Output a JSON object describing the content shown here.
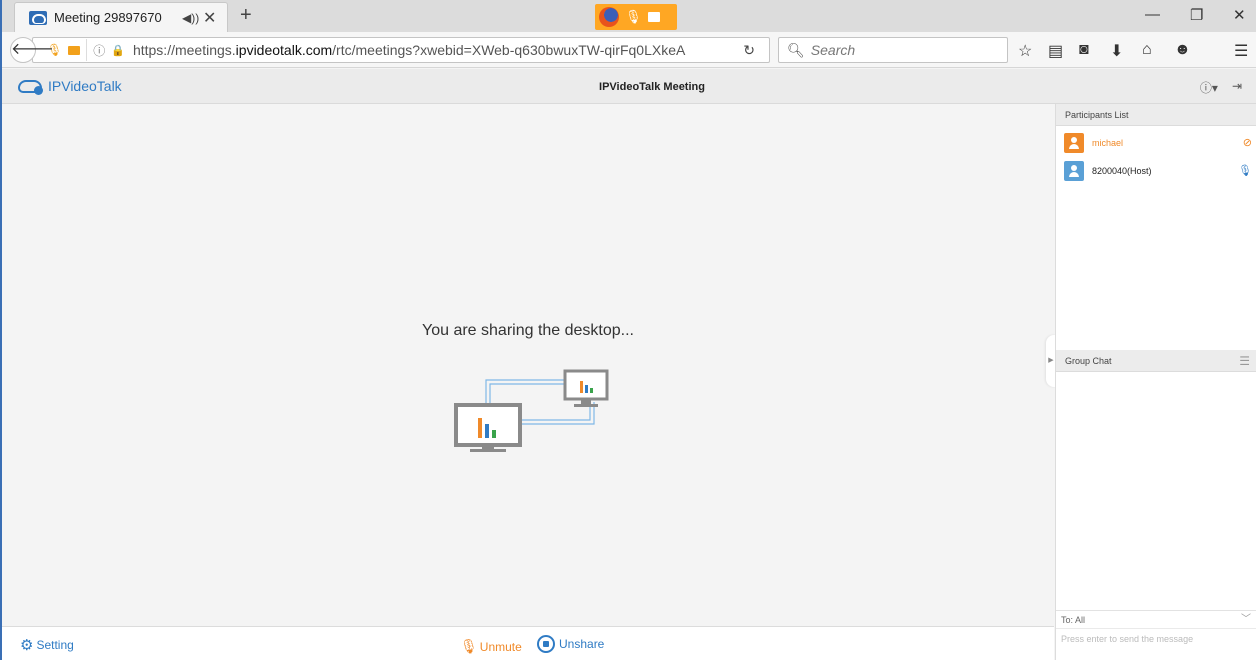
{
  "browser": {
    "tab_title": "Meeting 29897670",
    "speaker_icon": "speaker-icon",
    "close_tab": "✕",
    "new_tab": "+",
    "url_prefix": "https://meetings.",
    "url_domain": "ipvideotalk.com",
    "url_path": "/rtc/meetings?xwebid=XWeb-q630bwuxTW-qirFq0LXkeA",
    "search_placeholder": "Search",
    "window_controls": {
      "minimize": "—",
      "restore": "❐",
      "close": "✕"
    }
  },
  "app": {
    "logo_text": "IPVideoTalk",
    "title": "IPVideoTalk Meeting",
    "info_icon": "ⓘ",
    "info_caret": "▾",
    "exit_icon": "⇥"
  },
  "main": {
    "status_message": "You are sharing the desktop..."
  },
  "participants": {
    "header": "Participants List",
    "items": [
      {
        "name": "michael",
        "color": "#f08a2a",
        "avatar_color": "#f08a2a",
        "mic": "muted"
      },
      {
        "name": "8200040(Host)",
        "color": "#222222",
        "avatar_color": "#5aa0d6",
        "mic": "active"
      }
    ]
  },
  "chat": {
    "header": "Group Chat",
    "recipient": "To: All",
    "input_placeholder": "Press enter to send the message"
  },
  "bottom": {
    "setting_label": "Setting",
    "unmute_label": "Unmute",
    "unshare_label": "Unshare"
  },
  "colors": {
    "accent_blue": "#2f7bc4",
    "accent_orange": "#f08a2a"
  }
}
